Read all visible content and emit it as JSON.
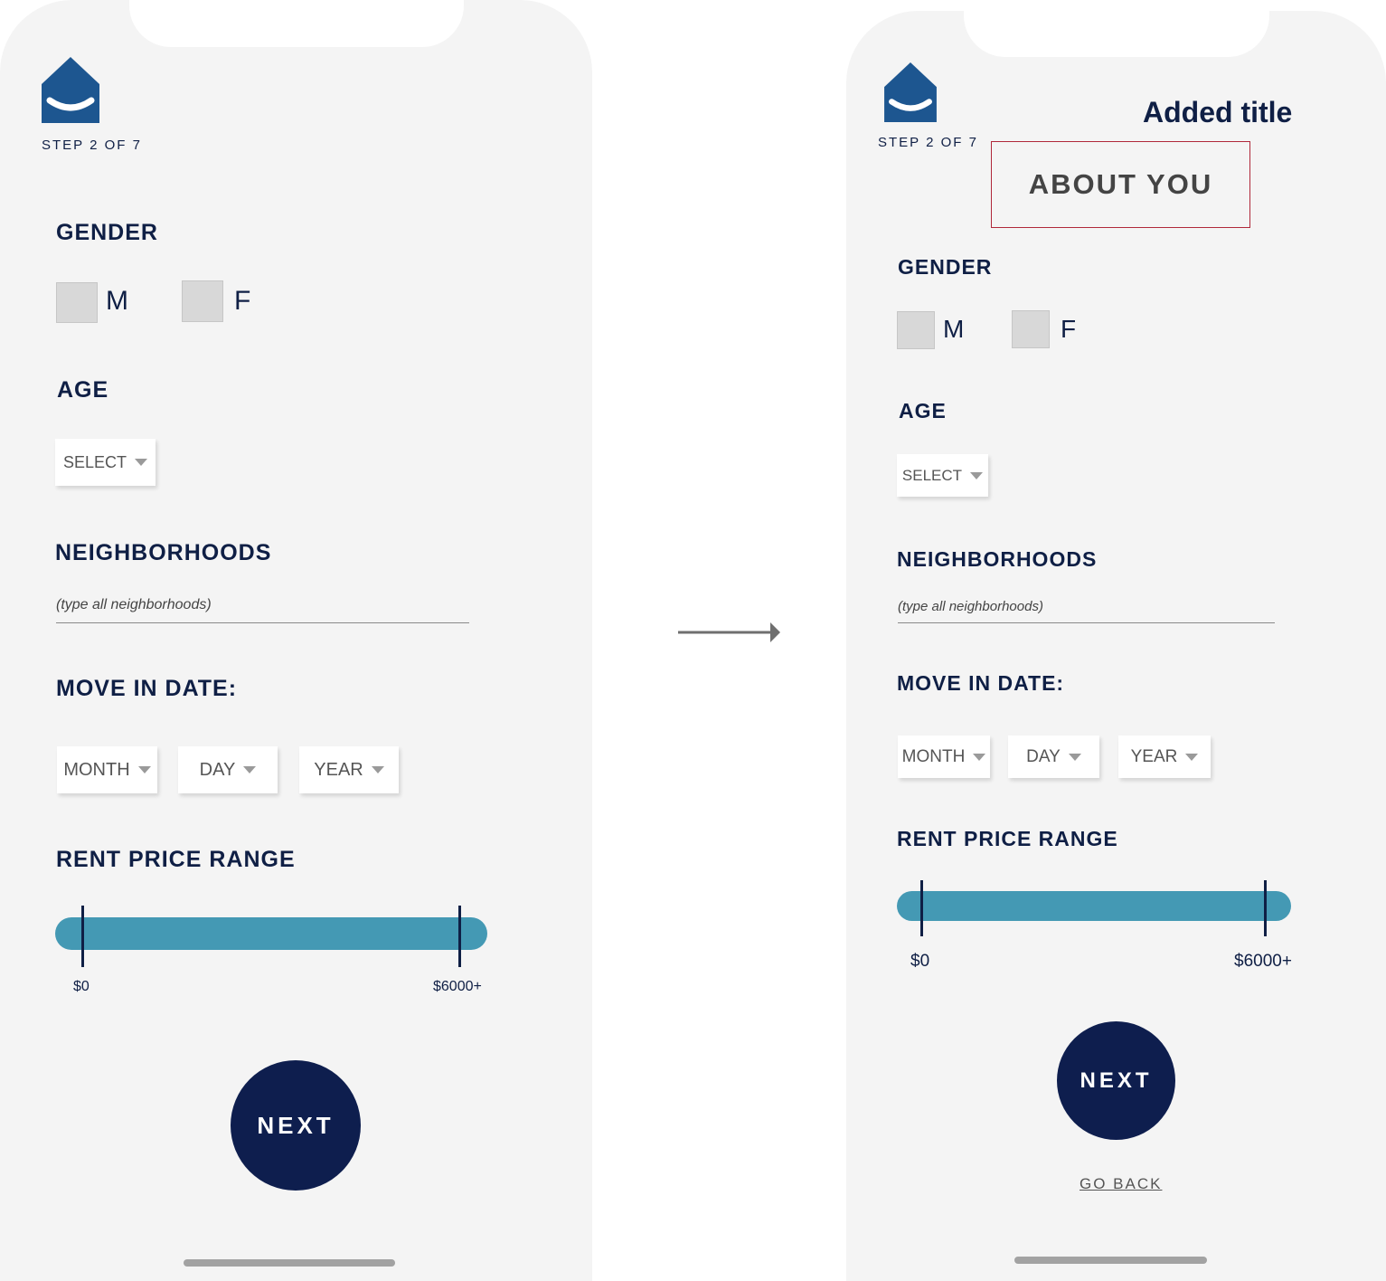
{
  "colors": {
    "navy": "#0f1f45",
    "next_button": "#0e1e4e",
    "slider_track": "#4499b4",
    "logo_blue": "#1d5690",
    "title_box_border": "#b0283a",
    "screen_bg": "#f4f4f4"
  },
  "before": {
    "step": "STEP 2 OF 7",
    "gender": {
      "label": "GENDER",
      "options": [
        "M",
        "F"
      ]
    },
    "age": {
      "label": "AGE",
      "select": "SELECT"
    },
    "neighborhoods": {
      "label": "NEIGHBORHOODS",
      "placeholder": "(type all neighborhoods)"
    },
    "move_in": {
      "label": "MOVE IN DATE:",
      "month": "MONTH",
      "day": "DAY",
      "year": "YEAR"
    },
    "rent": {
      "label": "RENT PRICE RANGE",
      "min": "$0",
      "max": "$6000+"
    },
    "next": "NEXT"
  },
  "after": {
    "annotation": "Added title",
    "title": "ABOUT YOU",
    "step": "STEP 2 OF 7",
    "gender": {
      "label": "GENDER",
      "options": [
        "M",
        "F"
      ]
    },
    "age": {
      "label": "AGE",
      "select": "SELECT"
    },
    "neighborhoods": {
      "label": "NEIGHBORHOODS",
      "placeholder": "(type all neighborhoods)"
    },
    "move_in": {
      "label": "MOVE IN DATE:",
      "month": "MONTH",
      "day": "DAY",
      "year": "YEAR"
    },
    "rent": {
      "label": "RENT PRICE RANGE",
      "min": "$0",
      "max": "$6000+"
    },
    "next": "NEXT",
    "go_back": "GO BACK"
  },
  "transition_arrow": "right-arrow-icon"
}
